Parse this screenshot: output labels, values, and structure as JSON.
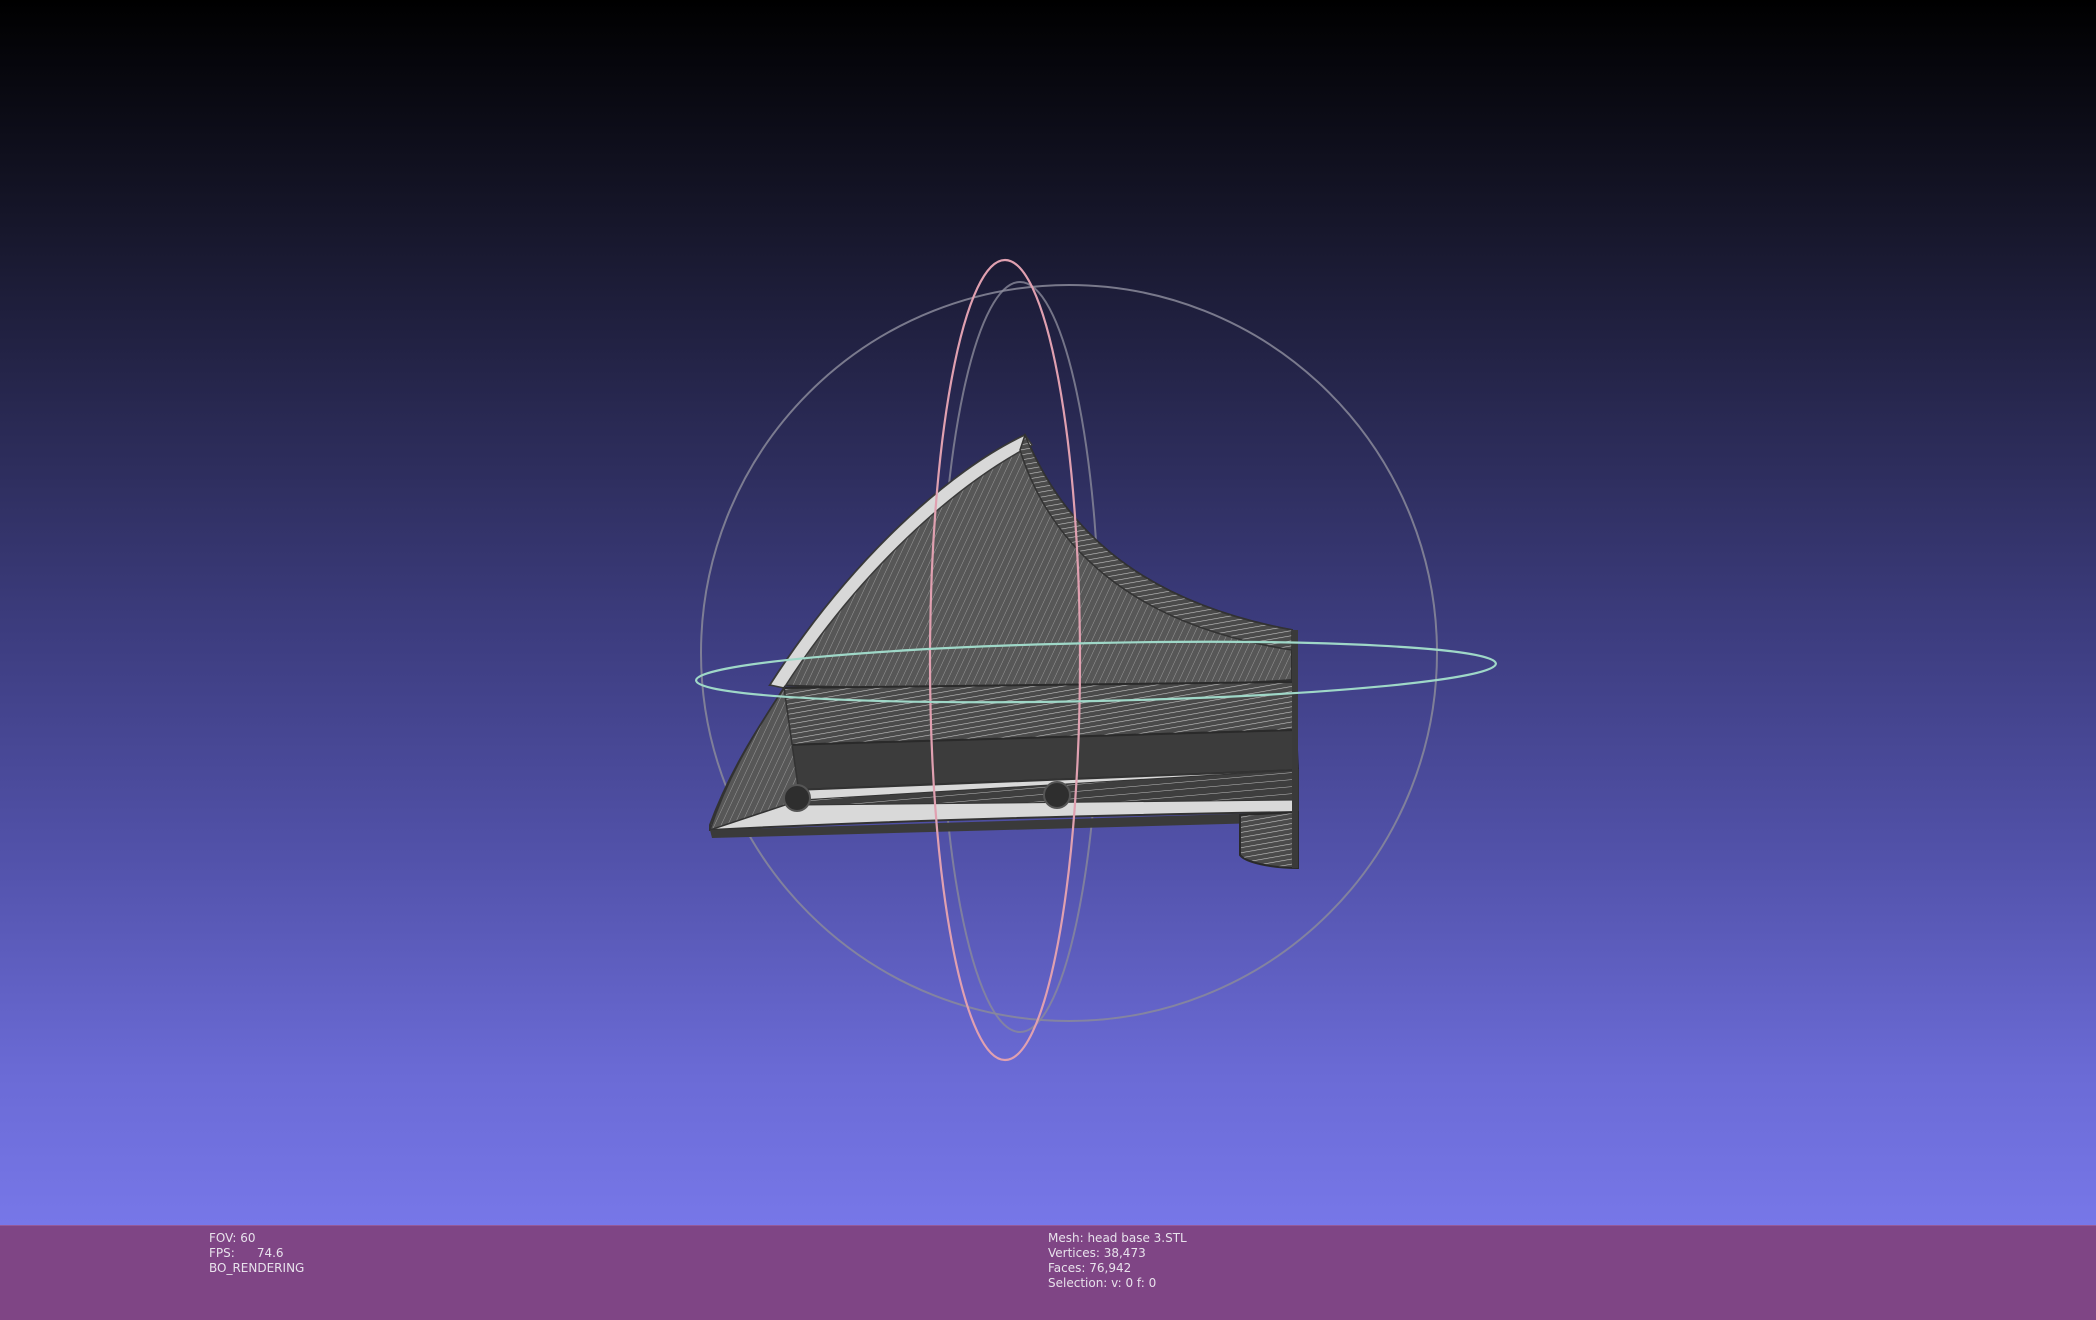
{
  "viewer": {
    "model_color": "#4a4a4a",
    "model_edge_color": "#d0d0d0",
    "background_top": "#000000",
    "background_bottom": "#7777e8",
    "trackball_ring_gray": "#8a8a9a",
    "trackball_ring_pink": "#e0a0b0",
    "trackball_ring_green": "#9fd8c8"
  },
  "info_left": {
    "fov_label": "FOV: 60",
    "fps_label": "FPS:",
    "fps_value": "74.6",
    "render_mode": "BO_RENDERING"
  },
  "info_right": {
    "mesh": "Mesh: head base 3.STL",
    "vertices": "Vertices: 38,473",
    "faces": "Faces: 76,942",
    "selection": "Selection: v: 0 f: 0"
  },
  "info_bar_color": "#7f4585"
}
